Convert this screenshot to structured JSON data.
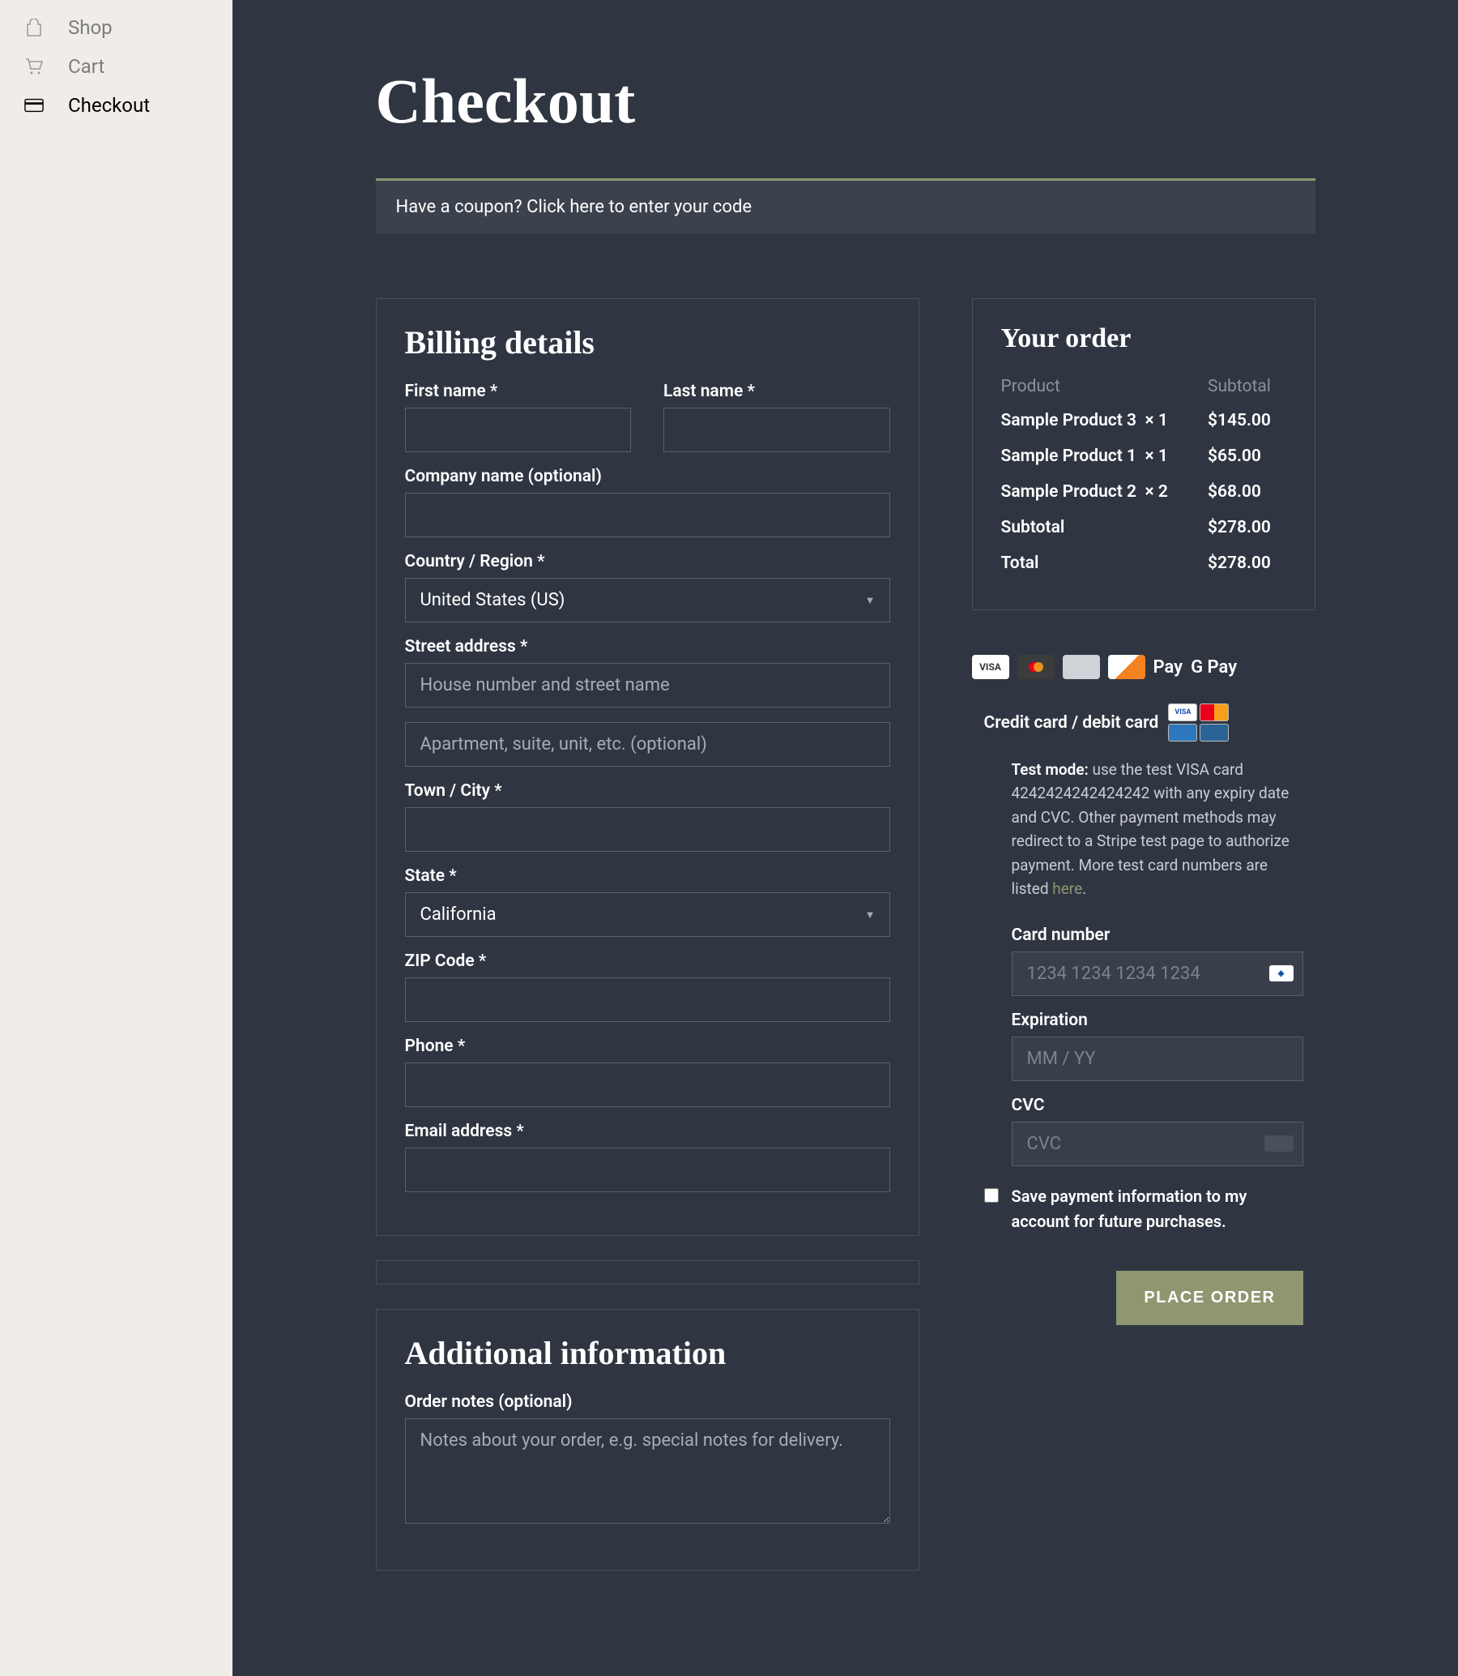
{
  "sidebar": {
    "items": [
      {
        "label": "Shop",
        "icon": "bag-icon",
        "active": false
      },
      {
        "label": "Cart",
        "icon": "cart-icon",
        "active": false
      },
      {
        "label": "Checkout",
        "icon": "card-icon",
        "active": true
      }
    ]
  },
  "page": {
    "title": "Checkout"
  },
  "coupon": {
    "prompt": "Have a coupon? ",
    "link": "Click here to enter your code"
  },
  "billing": {
    "heading": "Billing details",
    "first_name_label": "First name",
    "last_name_label": "Last name",
    "company_label": "Company name (optional)",
    "country_label": "Country / Region",
    "country_value": "United States (US)",
    "street_label": "Street address",
    "street_placeholder1": "House number and street name",
    "street_placeholder2": "Apartment, suite, unit, etc. (optional)",
    "town_label": "Town / City",
    "state_label": "State",
    "state_value": "California",
    "zip_label": "ZIP Code",
    "phone_label": "Phone",
    "email_label": "Email address"
  },
  "additional": {
    "heading": "Additional information",
    "notes_label": "Order notes (optional)",
    "notes_placeholder": "Notes about your order, e.g. special notes for delivery."
  },
  "order": {
    "heading": "Your order",
    "col_product": "Product",
    "col_subtotal": "Subtotal",
    "items": [
      {
        "name": "Sample Product 3",
        "qty": "× 1",
        "subtotal": "$145.00"
      },
      {
        "name": "Sample Product 1",
        "qty": "× 1",
        "subtotal": "$65.00"
      },
      {
        "name": "Sample Product 2",
        "qty": "× 2",
        "subtotal": "$68.00"
      }
    ],
    "subtotal_label": "Subtotal",
    "subtotal_value": "$278.00",
    "total_label": "Total",
    "total_value": "$278.00"
  },
  "pay_methods": {
    "visa": "VISA",
    "apple": " Pay",
    "gpay": "G Pay"
  },
  "payment": {
    "header": "Credit card / debit card",
    "test_strong": "Test mode:",
    "test_text1": " use the test VISA card 4242424242424242 with any expiry date and CVC. Other payment methods may redirect to a Stripe test page to authorize payment. More test card numbers are listed ",
    "test_link": "here",
    "card_number_label": "Card number",
    "card_number_placeholder": "1234 1234 1234 1234",
    "exp_label": "Expiration",
    "exp_placeholder": "MM / YY",
    "cvc_label": "CVC",
    "cvc_placeholder": "CVC",
    "save_label": "Save payment information to my account for future purchases.",
    "place_order": "PLACE ORDER"
  },
  "required_mark": "*"
}
